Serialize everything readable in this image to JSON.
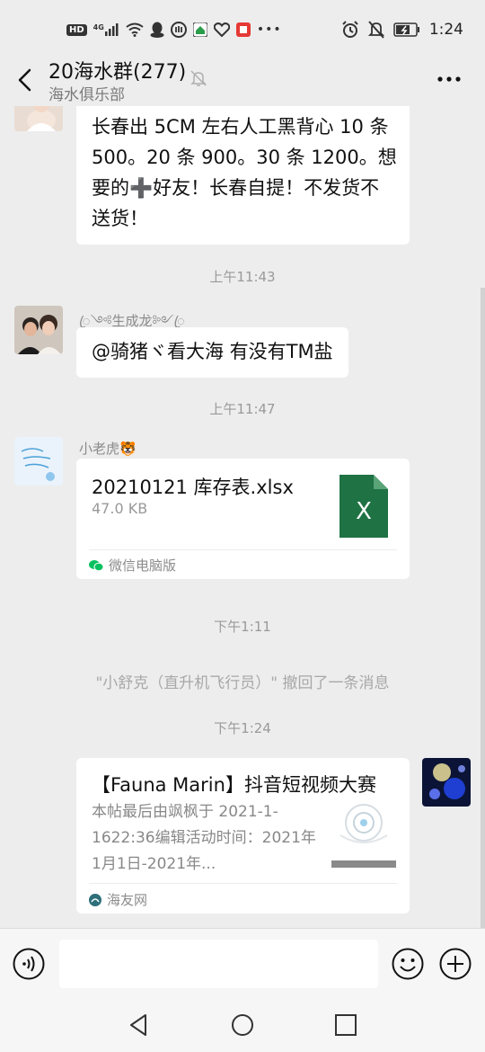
{
  "status_bar": {
    "hd": "HD",
    "signal": "4G",
    "time": "1:24"
  },
  "header": {
    "title": "20海水群(277)",
    "subtitle": "海水俱乐部"
  },
  "messages": {
    "msg1": {
      "text": "长春出 5CM 左右人工黑背心 10 条 500。20 条 900。30 条 1200。想要的➕好友！长春自提！不发货不送货！"
    },
    "time1": "上午11:43",
    "msg2": {
      "sender": "ꦿ༺生成龙༻ꦿ",
      "text": "@骑猪ヾ看大海 有没有TM盐"
    },
    "time2": "上午11:47",
    "msg3": {
      "sender": "小老虎🐯",
      "file_name": "20210121 库存表.xlsx",
      "file_size": "47.0 KB",
      "file_icon_letter": "X",
      "source": "微信电脑版"
    },
    "time3": "下午1:11",
    "recall": "\"小舒克（直升机飞行员）\" 撤回了一条消息",
    "time4": "下午1:24",
    "msg4": {
      "title": "【Fauna Marin】抖音短视频大赛",
      "desc": "本帖最后由飒枫于 2021-1-1622:36编辑活动时间：2021年1月1日-2021年...",
      "source": "海友网"
    }
  },
  "input": {
    "placeholder": ""
  },
  "icons": {
    "back": "chevron-left-icon",
    "mute": "bell-off-icon",
    "more": "more-dots-icon",
    "voice": "voice-icon",
    "emoji": "emoji-icon",
    "plus": "plus-circle-icon",
    "nav_back": "nav-back-icon",
    "nav_home": "nav-home-icon",
    "nav_recent": "nav-recent-icon"
  },
  "colors": {
    "background": "#ededed",
    "bubble": "#ffffff",
    "excel_green": "#1f7244",
    "wechat_green": "#07c160"
  }
}
